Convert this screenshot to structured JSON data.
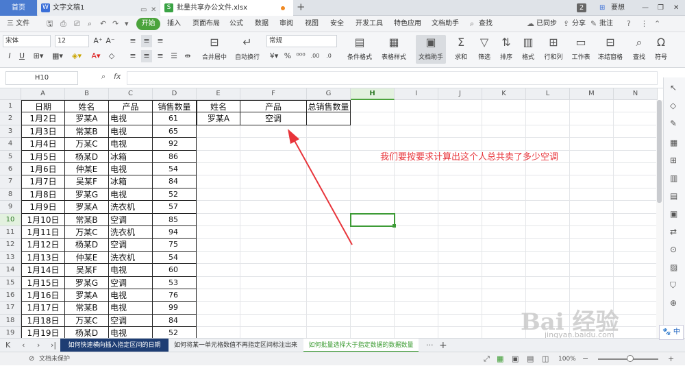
{
  "tabs": {
    "home": "首页",
    "doc": "文字文稿1",
    "xls": "批量共享办公文件.xlsx",
    "new_tab": "+",
    "count": "2",
    "user": "要想"
  },
  "menu": {
    "file": "三 文件",
    "start": "开始",
    "items": [
      "插入",
      "页面布局",
      "公式",
      "数据",
      "审阅",
      "视图",
      "安全",
      "开发工具",
      "特色应用",
      "文档助手"
    ],
    "search": "查找",
    "sync": "已同步",
    "share": "分享",
    "comment": "批注"
  },
  "ribbon": {
    "font_name": "宋体",
    "font_size": "12",
    "number_format": "常规",
    "buttons": [
      {
        "label": "合并居中",
        "icon": "merge-icon"
      },
      {
        "label": "自动换行",
        "icon": "wrap-icon"
      },
      {
        "label": "条件格式",
        "icon": "conditional-format-icon"
      },
      {
        "label": "表格样式",
        "icon": "table-style-icon"
      },
      {
        "label": "文档助手",
        "icon": "doc-assistant-icon"
      },
      {
        "label": "求和",
        "icon": "sum-icon"
      },
      {
        "label": "筛选",
        "icon": "filter-icon"
      },
      {
        "label": "排序",
        "icon": "sort-icon"
      },
      {
        "label": "格式",
        "icon": "format-icon"
      },
      {
        "label": "行和列",
        "icon": "row-col-icon"
      },
      {
        "label": "工作表",
        "icon": "worksheet-icon"
      },
      {
        "label": "冻结窗格",
        "icon": "freeze-icon"
      },
      {
        "label": "查找",
        "icon": "find-icon"
      },
      {
        "label": "符号",
        "icon": "symbol-icon"
      }
    ]
  },
  "formula": {
    "name_box": "H10",
    "fx": "fx",
    "value": ""
  },
  "columns": [
    "A",
    "B",
    "C",
    "D",
    "E",
    "F",
    "G",
    "H",
    "I",
    "J",
    "K",
    "L",
    "M",
    "N"
  ],
  "selected": {
    "col": "H",
    "row": "10"
  },
  "header_row": {
    "A": "日期",
    "B": "姓名",
    "C": "产品",
    "D": "销售数量",
    "E": "姓名",
    "F": "产品",
    "G": "总销售数量"
  },
  "criteria_row": {
    "E": "罗某A",
    "F": "空调",
    "G": ""
  },
  "data_rows": [
    {
      "row": "2",
      "date": "1月2日",
      "name": "罗某A",
      "product": "电视",
      "qty": "61"
    },
    {
      "row": "3",
      "date": "1月3日",
      "name": "常某B",
      "product": "电视",
      "qty": "65"
    },
    {
      "row": "4",
      "date": "1月4日",
      "name": "万某C",
      "product": "电视",
      "qty": "92"
    },
    {
      "row": "5",
      "date": "1月5日",
      "name": "杨某D",
      "product": "冰箱",
      "qty": "86"
    },
    {
      "row": "6",
      "date": "1月6日",
      "name": "仲某E",
      "product": "电视",
      "qty": "54"
    },
    {
      "row": "7",
      "date": "1月7日",
      "name": "吴某F",
      "product": "冰箱",
      "qty": "84"
    },
    {
      "row": "8",
      "date": "1月8日",
      "name": "罗某G",
      "product": "电视",
      "qty": "52"
    },
    {
      "row": "9",
      "date": "1月9日",
      "name": "罗某A",
      "product": "洗衣机",
      "qty": "57"
    },
    {
      "row": "10",
      "date": "1月10日",
      "name": "常某B",
      "product": "空调",
      "qty": "85"
    },
    {
      "row": "11",
      "date": "1月11日",
      "name": "万某C",
      "product": "洗衣机",
      "qty": "94"
    },
    {
      "row": "12",
      "date": "1月12日",
      "name": "杨某D",
      "product": "空调",
      "qty": "75"
    },
    {
      "row": "13",
      "date": "1月13日",
      "name": "仲某E",
      "product": "洗衣机",
      "qty": "54"
    },
    {
      "row": "14",
      "date": "1月14日",
      "name": "吴某F",
      "product": "电视",
      "qty": "60"
    },
    {
      "row": "15",
      "date": "1月15日",
      "name": "罗某G",
      "product": "空调",
      "qty": "53"
    },
    {
      "row": "16",
      "date": "1月16日",
      "name": "罗某A",
      "product": "电视",
      "qty": "76"
    },
    {
      "row": "17",
      "date": "1月17日",
      "name": "常某B",
      "product": "电视",
      "qty": "99"
    },
    {
      "row": "18",
      "date": "1月18日",
      "name": "万某C",
      "product": "空调",
      "qty": "84"
    },
    {
      "row": "19",
      "date": "1月19日",
      "name": "杨某D",
      "product": "电视",
      "qty": "52"
    }
  ],
  "annotation": "我们要按要求计算出这个人总共卖了多少空调",
  "sheet_tabs": {
    "tab1": "如何快速横向插入指定区间的日期",
    "tab2": "如何将某一单元格数值不再指定区间标注出来",
    "tab3": "如何批量选择大于指定数据的数据数量",
    "more": "···",
    "add": "+"
  },
  "status": {
    "protect": "文档未保护",
    "zoom": "100%",
    "ime": "中"
  },
  "watermark": {
    "text": "Bai 经验",
    "url": "jingyan.baidu.com"
  },
  "colors": {
    "accent": "#4ba33c",
    "annotation": "#e8343a",
    "dark_tab": "#1e3d73"
  }
}
